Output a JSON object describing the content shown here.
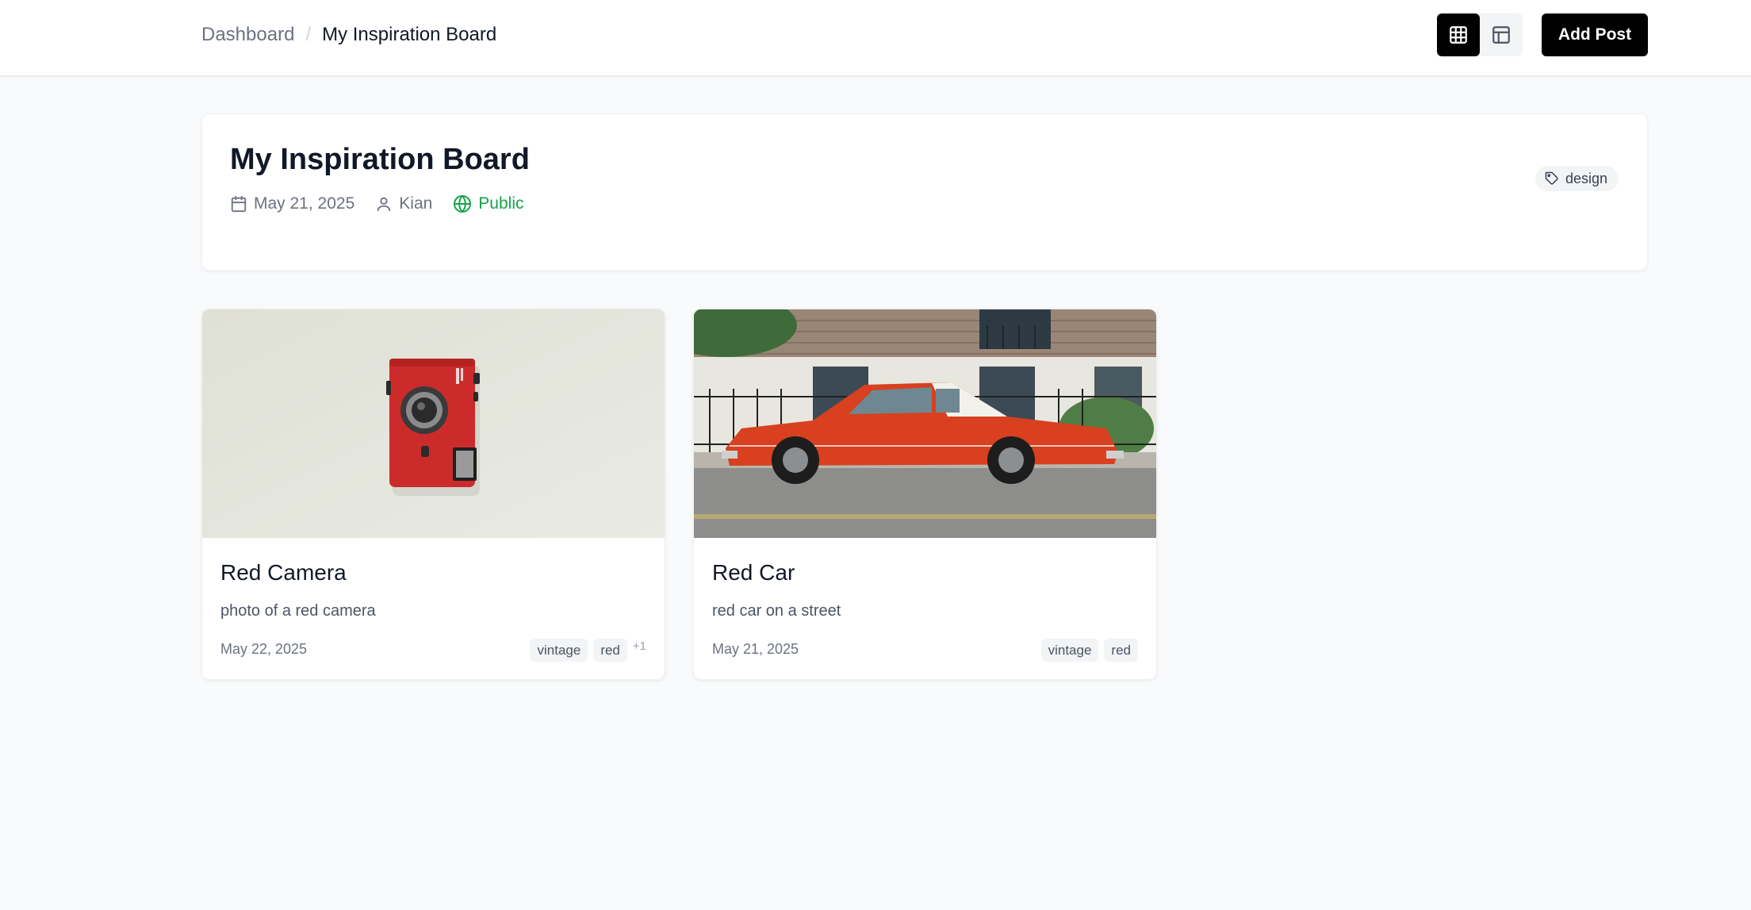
{
  "header": {
    "breadcrumb": {
      "root": "Dashboard",
      "separator": "/",
      "current": "My Inspiration Board"
    },
    "view_toggle": {
      "active": "grid",
      "icons": [
        "grid-icon",
        "layout-icon"
      ]
    },
    "add_post_label": "Add Post"
  },
  "board": {
    "title": "My Inspiration Board",
    "date": "May 21, 2025",
    "author": "Kian",
    "visibility": "Public",
    "tag": "design"
  },
  "posts": [
    {
      "title": "Red Camera",
      "description": "photo of a red camera",
      "date": "May 22, 2025",
      "tags": [
        "vintage",
        "red"
      ],
      "more_tags": "+1",
      "image": "red-camera-photo"
    },
    {
      "title": "Red Car",
      "description": "red car on a street",
      "date": "May 21, 2025",
      "tags": [
        "vintage",
        "red"
      ],
      "image": "red-car-photo"
    }
  ],
  "colors": {
    "accent": "#000000",
    "public": "#16a34a",
    "background": "#f9fafb"
  }
}
